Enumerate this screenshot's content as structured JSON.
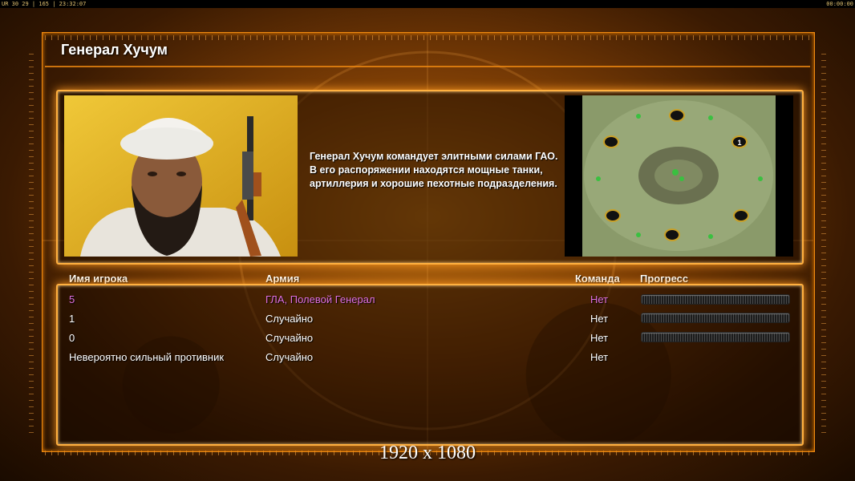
{
  "hud": {
    "left": "UR 30 29 | 165 | 23:32:07",
    "right": "00:00:00"
  },
  "title": "Генерал Хучум",
  "description": "Генерал Хучум командует элитными силами ГАО. В его распоряжении находятся мощные танки, артиллерия и хорошие пехотные подразделения.",
  "minimap": {
    "player_marker": "1"
  },
  "columns": {
    "name": "Имя игрока",
    "army": "Армия",
    "team": "Команда",
    "progress": "Прогресс"
  },
  "players": [
    {
      "name": "5",
      "army": "ГЛА, Полевой Генерал",
      "team": "Нет",
      "progress": 0,
      "highlight": true
    },
    {
      "name": "1",
      "army": "Случайно",
      "team": "Нет",
      "progress": 0
    },
    {
      "name": "0",
      "army": "Случайно",
      "team": "Нет",
      "progress": 0
    },
    {
      "name": "Невероятно сильный противник",
      "army": "Случайно",
      "team": "Нет"
    }
  ],
  "resolution_watermark": "1920 x 1080",
  "colors": {
    "accent": "#f08a10",
    "highlight_text": "#e070e0"
  }
}
